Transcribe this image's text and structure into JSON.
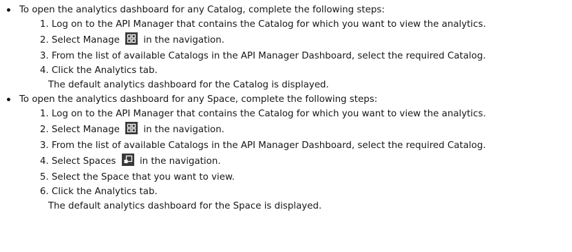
{
  "bullets": [
    {
      "text": "To open the analytics dashboard for any Catalog, complete the following steps:",
      "steps": [
        {
          "num": "1.",
          "text": "Log on to the API Manager that contains the Catalog for which you want to view the analytics."
        },
        {
          "num": "2.",
          "before": "Select Manage",
          "after": "in the navigation.",
          "icon": "manage-grid-icon"
        },
        {
          "num": "3.",
          "text": "From the list of available Catalogs in the API Manager Dashboard, select the required Catalog."
        },
        {
          "num": "4.",
          "text": "Click the Analytics tab."
        }
      ],
      "result": "The default analytics dashboard for the Catalog is displayed."
    },
    {
      "text": "To open the analytics dashboard for any Space, complete the following steps:",
      "steps": [
        {
          "num": "1.",
          "text": "Log on to the API Manager that contains the Catalog for which you want to view the analytics."
        },
        {
          "num": "2.",
          "before": "Select Manage",
          "after": "in the navigation.",
          "icon": "manage-grid-icon"
        },
        {
          "num": "3.",
          "text": "From the list of available Catalogs in the API Manager Dashboard, select the required Catalog."
        },
        {
          "num": "4.",
          "before": "Select Spaces",
          "after": "in the navigation.",
          "icon": "spaces-icon"
        },
        {
          "num": "5.",
          "text": "Select the Space that you want to view."
        },
        {
          "num": "6.",
          "text": "Click the Analytics tab."
        }
      ],
      "result": "The default analytics dashboard for the Space is displayed."
    }
  ]
}
